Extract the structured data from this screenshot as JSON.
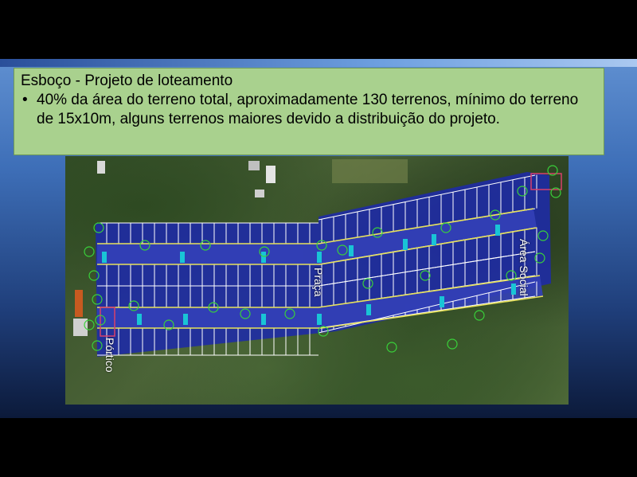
{
  "slide": {
    "title": "Esboço - Projeto de loteamento",
    "bullet_marker": "•",
    "bullet_text": "40% da área do terreno total, aproximadamente 130 terrenos, mínimo do terreno de 15x10m, alguns terrenos maiores devido a distribuição do projeto."
  },
  "map_labels": {
    "area_social": "Área Social",
    "praca": "Praça",
    "portico": "Pórtico"
  },
  "colors": {
    "textbox_bg": "#a9d18e",
    "lot_fill": "#1e2aa8",
    "lot_lines": "#ffffff",
    "tree_circles": "#39d23a",
    "path_markers": "#19c4d6"
  }
}
